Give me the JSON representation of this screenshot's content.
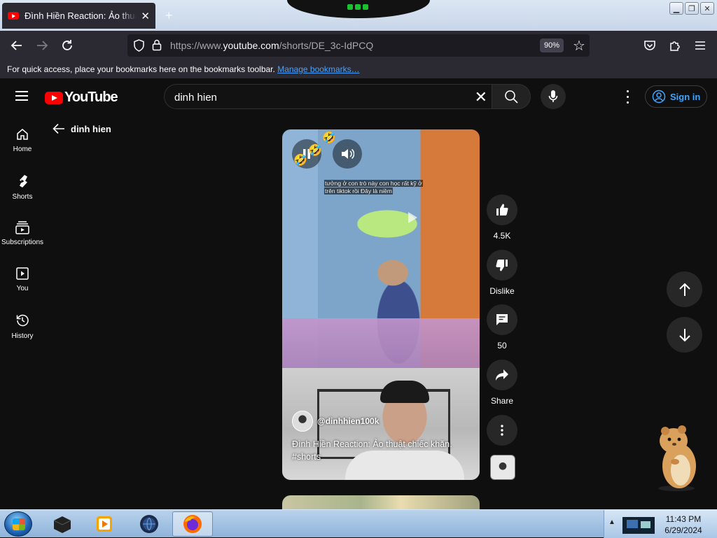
{
  "browser": {
    "tab_title": "Đình Hiền Reaction:⁠ Ảo thuật chiếc khăn",
    "tab_close": "✕",
    "new_tab": "+",
    "url_base": "https://www.",
    "url_domain": "youtube.com",
    "url_path": "/shorts/DE_3c-IdPCQ",
    "zoom": "90%",
    "bookmarks_msg": "For quick access, place your bookmarks here on the bookmarks toolbar.",
    "bookmarks_link": "Manage bookmarks…"
  },
  "youtube": {
    "logo_text": "YouTube",
    "search_value": "dinh hien",
    "sign_in": "Sign in",
    "back_query": "dinh hien"
  },
  "sidebar": {
    "items": [
      {
        "label": "Home",
        "icon": "home-icon"
      },
      {
        "label": "Shorts",
        "icon": "shorts-icon"
      },
      {
        "label": "Subscriptions",
        "icon": "subscriptions-icon"
      },
      {
        "label": "You",
        "icon": "you-icon"
      },
      {
        "label": "History",
        "icon": "history-icon"
      }
    ]
  },
  "short": {
    "caption_line1": "tưởng ở con trò này con học rất kỹ ở",
    "caption_line2": "trên tiktok rồi Đây là niềm",
    "channel": "@dinhhien100k",
    "title": "Đình Hiền Reaction:⁠ Ảo thuật chiếc khăn.",
    "hashtag": "#shorts",
    "emoji": "🤣"
  },
  "actions": {
    "likes": "4.5K",
    "dislike": "Dislike",
    "comments": "50",
    "share": "Share"
  },
  "taskbar": {
    "time": "11:43 PM",
    "date": "6/29/2024"
  },
  "colors": {
    "yt_red": "#ff0000",
    "link_blue": "#3ea6ff",
    "dark_bg": "#0f0f0f",
    "chip_bg": "#272727"
  }
}
